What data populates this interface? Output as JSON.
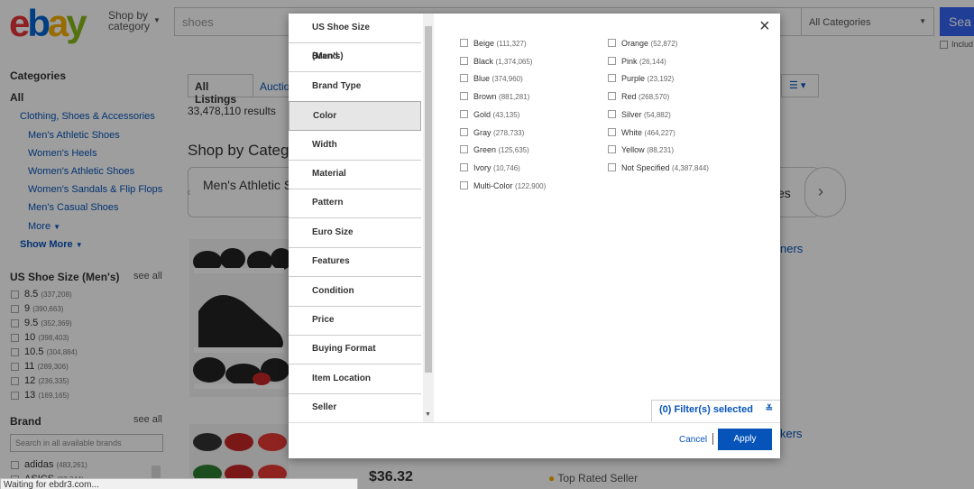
{
  "header": {
    "logo_letters": [
      "e",
      "b",
      "a",
      "y"
    ],
    "logo_colors": [
      "#e53238",
      "#0064d2",
      "#f5af02",
      "#86b817"
    ],
    "shop_by_line1": "Shop by",
    "shop_by_line2": "category",
    "search_value": "shoes",
    "category_select": "All Categories",
    "search_button": "Sea",
    "include_label": "Includ"
  },
  "sidebar": {
    "categories_heading": "Categories",
    "all_label": "All",
    "parent_category": "Clothing, Shoes & Accessories",
    "subcategories": [
      "Men's Athletic Shoes",
      "Women's Heels",
      "Women's Athletic Shoes",
      "Women's Sandals & Flip Flops",
      "Men's Casual Shoes"
    ],
    "more_label": "More",
    "show_more_label": "Show More",
    "size_heading": "US Shoe Size (Men's)",
    "see_all": "see all",
    "sizes": [
      {
        "label": "8.5",
        "count": "(337,208)"
      },
      {
        "label": "9",
        "count": "(390,663)"
      },
      {
        "label": "9.5",
        "count": "(352,369)"
      },
      {
        "label": "10",
        "count": "(398,403)"
      },
      {
        "label": "10.5",
        "count": "(304,884)"
      },
      {
        "label": "11",
        "count": "(289,306)"
      },
      {
        "label": "12",
        "count": "(236,335)"
      },
      {
        "label": "13",
        "count": "(169,165)"
      }
    ],
    "brand_heading": "Brand",
    "brand_search_placeholder": "Search in all available brands",
    "brands": [
      {
        "label": "adidas",
        "count": "(483,261)"
      },
      {
        "label": "ASICS",
        "count": "(82,344)"
      }
    ]
  },
  "main": {
    "tab_all": "All Listings",
    "tab_auction": "Auction",
    "results_count": "33,478,110 results",
    "shop_by_category": "Shop by Catego",
    "carousel_item": "Men's Athletic S",
    "carousel_right_text": "es",
    "related_link_1": "ners",
    "related_link_2": "kers",
    "price": "$36.32",
    "top_rated": "Top Rated Seller"
  },
  "status_bar": "Waiting for ebdr3.com...",
  "modal": {
    "nav": [
      "US Shoe Size (Men's)",
      "Brand",
      "Brand Type",
      "Color",
      "Width",
      "Material",
      "Pattern",
      "Euro Size",
      "Features",
      "Condition",
      "Price",
      "Buying Format",
      "Item Location",
      "Seller"
    ],
    "active_index": 3,
    "options_col1": [
      {
        "label": "Beige",
        "count": "(111,327)"
      },
      {
        "label": "Black",
        "count": "(1,374,065)"
      },
      {
        "label": "Blue",
        "count": "(374,960)"
      },
      {
        "label": "Brown",
        "count": "(881,281)"
      },
      {
        "label": "Gold",
        "count": "(43,135)"
      },
      {
        "label": "Gray",
        "count": "(278,733)"
      },
      {
        "label": "Green",
        "count": "(125,635)"
      },
      {
        "label": "Ivory",
        "count": "(10,746)"
      },
      {
        "label": "Multi-Color",
        "count": "(122,900)"
      }
    ],
    "options_col2": [
      {
        "label": "Orange",
        "count": "(52,872)"
      },
      {
        "label": "Pink",
        "count": "(26,144)"
      },
      {
        "label": "Purple",
        "count": "(23,192)"
      },
      {
        "label": "Red",
        "count": "(268,570)"
      },
      {
        "label": "Silver",
        "count": "(54,882)"
      },
      {
        "label": "White",
        "count": "(464,227)"
      },
      {
        "label": "Yellow",
        "count": "(88,231)"
      },
      {
        "label": "Not Specified",
        "count": "(4,387,844)"
      }
    ],
    "filters_selected": "(0) Filter(s) selected",
    "cancel_label": "Cancel",
    "apply_label": "Apply",
    "close_icon": "×"
  }
}
